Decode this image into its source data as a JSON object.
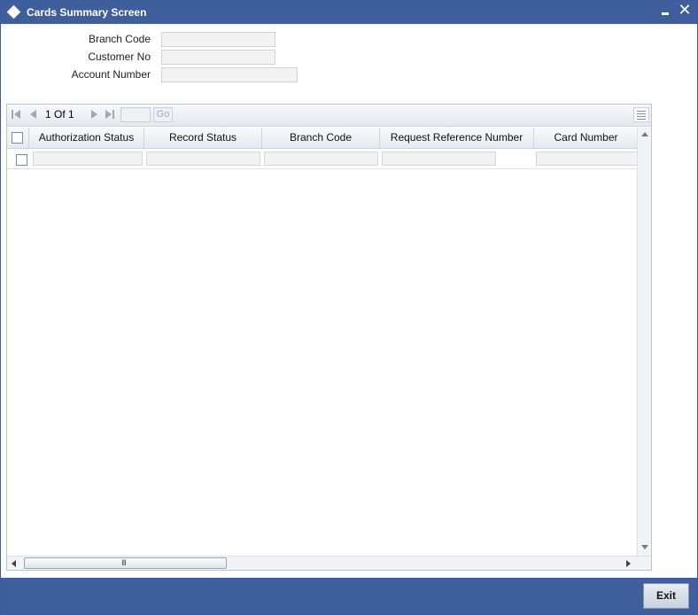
{
  "window": {
    "title": "Cards Summary Screen",
    "minimize_icon": "minimize-icon",
    "close_icon": "close-icon",
    "close_glyph": "✕"
  },
  "form": {
    "branch_code": {
      "label": "Branch Code",
      "value": ""
    },
    "customer_no": {
      "label": "Customer No",
      "value": ""
    },
    "account_number": {
      "label": "Account Number",
      "value": ""
    }
  },
  "pager": {
    "page_text": "1 Of 1",
    "go_label": "Go",
    "page_input_value": "",
    "icons": [
      "first-page-icon",
      "prev-page-icon",
      "next-page-icon",
      "last-page-icon",
      "grid-menu-icon"
    ]
  },
  "grid": {
    "columns": [
      "Authorization Status",
      "Record Status",
      "Branch Code",
      "Request Reference Number",
      "Card Number"
    ],
    "rows": [
      [
        "",
        "",
        "",
        "",
        ""
      ]
    ]
  },
  "footer": {
    "exit_label": "Exit"
  },
  "colors": {
    "titlebar": "#3e5f9b",
    "footer": "#3e5f9b",
    "field_bg": "#f3f3f3"
  }
}
